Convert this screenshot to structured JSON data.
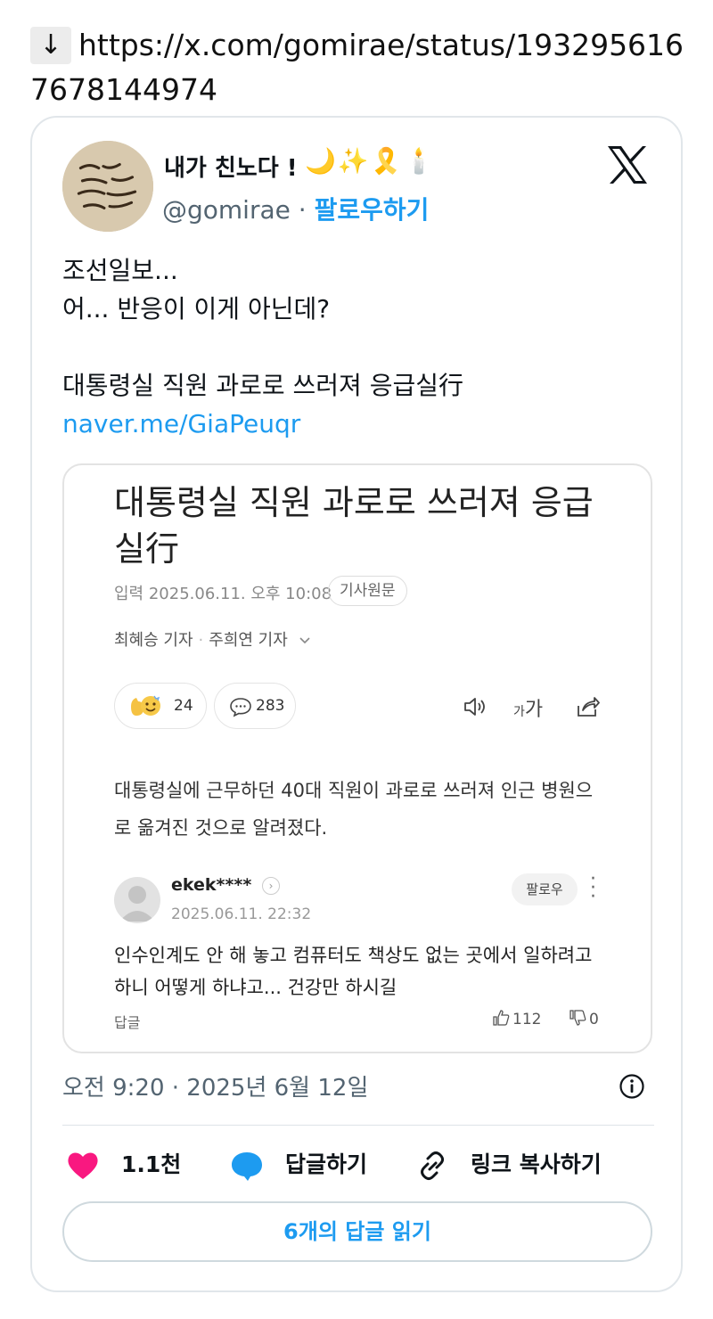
{
  "share": {
    "arrow": "↓",
    "url": "https://x.com/gomirae/status/1932956167678144974"
  },
  "tweet": {
    "author_name": "내가 친노다 !",
    "author_emoji": "🌙✨🎗️🕯️",
    "handle": "@gomirae",
    "dot": "·",
    "follow": "팔로우하기",
    "body_lines": [
      "조선일보...",
      "어... 반응이 이게 아닌데?",
      "",
      "대통령실 직원 과로로 쓰러져 응급실行"
    ],
    "link": "naver.me/GiaPeuqr",
    "timestamp": "오전 9:20 · 2025년 6월 12일",
    "likes": "1.1천",
    "reply_label": "답글하기",
    "copy_link_label": "링크 복사하기",
    "read_replies": "6개의 답글 읽기"
  },
  "article": {
    "title": "대통령실 직원 과로로 쓰러져 응급실行",
    "published": "입력 2025.06.11. 오후 10:08",
    "original_button": "기사원문",
    "reporter_1": "최혜승 기자",
    "reporter_2": "주희연 기자",
    "reaction_count": "24",
    "comment_count": "283",
    "font_tool_small": "가",
    "font_tool_large": "가",
    "lede": "대통령실에 근무하던 40대 직원이 과로로 쓰러져 인근 병원으로 옮겨진 것으로 알려졌다."
  },
  "comment": {
    "user": "ekek****",
    "date": "2025.06.11. 22:32",
    "follow": "팔로우",
    "text": "인수인계도 안 해 놓고 컴퓨터도 책상도 없는 곳에서 일하려고 하니 어떻게 하냐고... 건강만 하시길",
    "reply": "답글",
    "upvotes": "112",
    "downvotes": "0"
  },
  "colors": {
    "link_blue": "#1d9bf0",
    "like_pink": "#f91880",
    "muted_gray": "#536471"
  },
  "icons": [
    "x-logo-icon",
    "info-icon",
    "heart-icon",
    "reply-bubble-icon",
    "link-icon",
    "speaker-icon",
    "share-icon",
    "thumb-up-icon",
    "thumb-down-icon"
  ]
}
